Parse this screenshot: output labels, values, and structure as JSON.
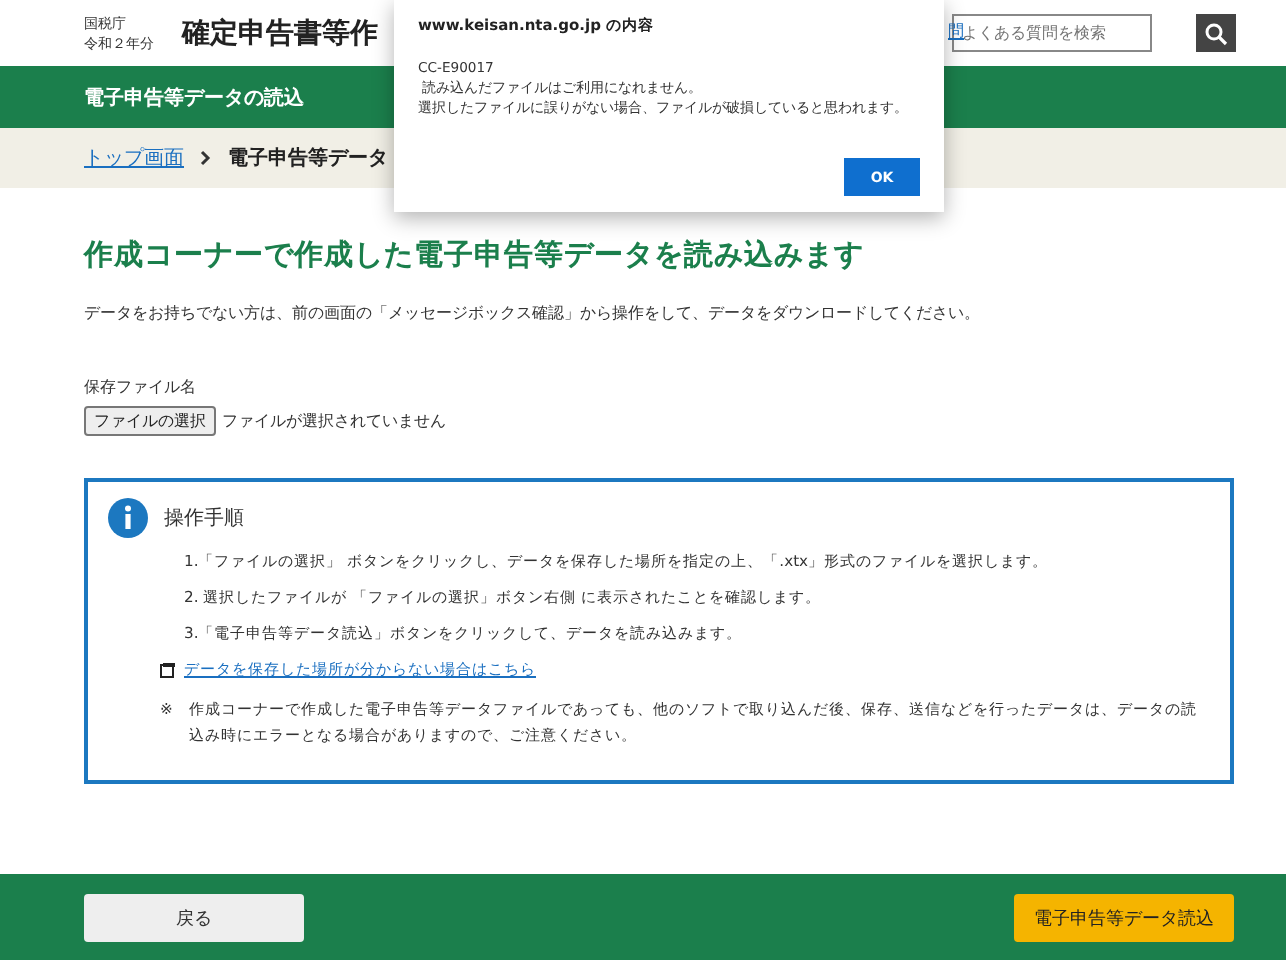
{
  "header": {
    "agency": "国税庁",
    "year": "令和２年分",
    "title": "確定申告書等作",
    "link": "問",
    "search": {
      "placeholder": "よくある質問を検索"
    }
  },
  "section_bar": {
    "title": "電子申告等データの読込"
  },
  "breadcrumb": [
    {
      "label": "トップ画面",
      "link": true
    },
    {
      "label": "電子申告等データ",
      "link": false
    }
  ],
  "dialog": {
    "title": "www.keisan.nta.go.jp の内容",
    "code": "CC-E90017",
    "lines": [
      " 読み込んだファイルはご利用になれません。",
      "選択したファイルに誤りがない場合、ファイルが破損していると思われます。"
    ],
    "ok": "OK"
  },
  "heading": "作成コーナーで作成した電子申告等データを読み込みます",
  "intro": "データをお持ちでない方は、前の画面の「メッセージボックス確認」から操作をして、データをダウンロードしてください。",
  "file": {
    "label": "保存ファイル名",
    "button": "ファイルの選択",
    "status": "ファイルが選択されていません"
  },
  "info": {
    "title": "操作手順",
    "steps": [
      "1.「ファイルの選択」 ボタンをクリックし、データを保存した場所を指定の上、「.xtx」形式のファイルを選択します。",
      "2. 選択したファイルが 「ファイルの選択」ボタン右側 に表示されたことを確認します。",
      "3.「電子申告等データ読込」ボタンをクリックして、データを読み込みます。"
    ],
    "link": "データを保存した場所が分からない場合はこちら",
    "note_mark": "※",
    "note": "作成コーナーで作成した電子申告等データファイルであっても、他のソフトで取り込んだ後、保存、送信などを行ったデータは、データの読込み時にエラーとなる場合がありますので、ご注意ください。"
  },
  "footer": {
    "back": "戻る",
    "submit": "電子申告等データ読込"
  }
}
